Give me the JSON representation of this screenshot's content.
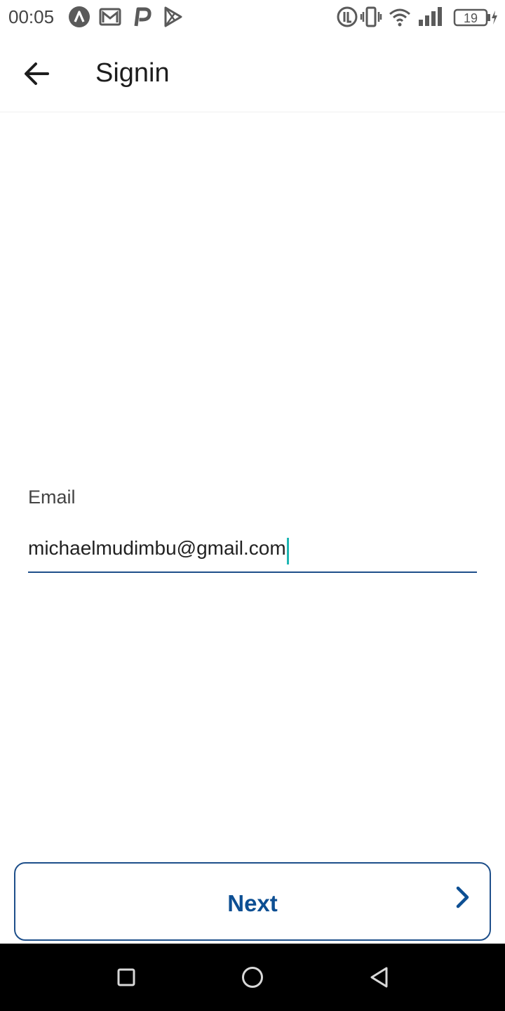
{
  "status_bar": {
    "time": "00:05",
    "battery_level": "19",
    "icons_left": [
      "app-a-icon",
      "gmail-icon",
      "p-icon",
      "play-store-icon"
    ],
    "icons_right": [
      "hd-call-icon",
      "vibrate-icon",
      "wifi-icon",
      "signal-icon",
      "battery-icon",
      "charging-icon"
    ]
  },
  "app_bar": {
    "title": "Signin"
  },
  "form": {
    "email_label": "Email",
    "email_value": "michaelmudimbu@gmail.com"
  },
  "actions": {
    "next_label": "Next"
  },
  "colors": {
    "accent": "#1e4f8a",
    "button_text": "#0d4f93",
    "caret": "#1fb6b3",
    "nav_bar": "#000000"
  }
}
